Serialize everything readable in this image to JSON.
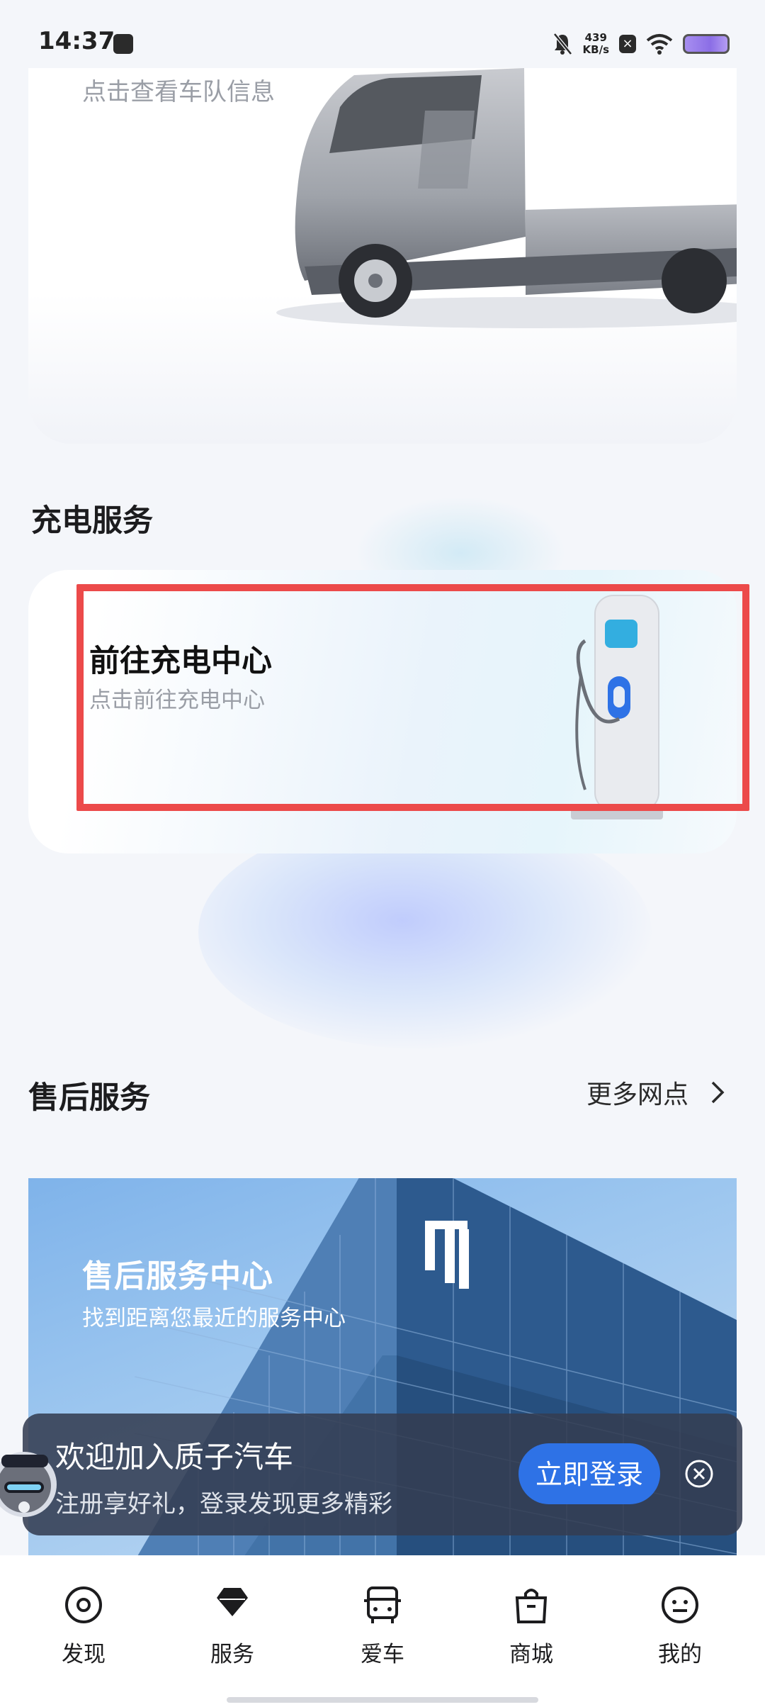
{
  "status_bar": {
    "time": "14:37",
    "net_speed_value": "439",
    "net_speed_unit": "KB/s"
  },
  "fleet_card": {
    "subtitle": "点击查看车队信息"
  },
  "charging": {
    "section_title": "充电服务",
    "card_title": "前往充电中心",
    "card_subtitle": "点击前往充电中心"
  },
  "after_sales": {
    "section_title": "售后服务",
    "more_label": "更多网点",
    "card_title": "售后服务中心",
    "card_subtitle": "找到距离您最近的服务中心"
  },
  "login_banner": {
    "title": "欢迎加入质子汽车",
    "subtitle": "注册享好礼，登录发现更多精彩",
    "button_label": "立即登录"
  },
  "bottom_nav": {
    "items": [
      {
        "label": "发现",
        "icon": "discover-icon"
      },
      {
        "label": "服务",
        "icon": "service-icon"
      },
      {
        "label": "爱车",
        "icon": "car-icon"
      },
      {
        "label": "商城",
        "icon": "shop-bag-icon"
      },
      {
        "label": "我的",
        "icon": "profile-icon"
      }
    ],
    "active_index": 1
  },
  "colors": {
    "accent_blue": "#2e72e6",
    "highlight_red": "#ec4a4a",
    "banner_bg": "#343e52"
  }
}
